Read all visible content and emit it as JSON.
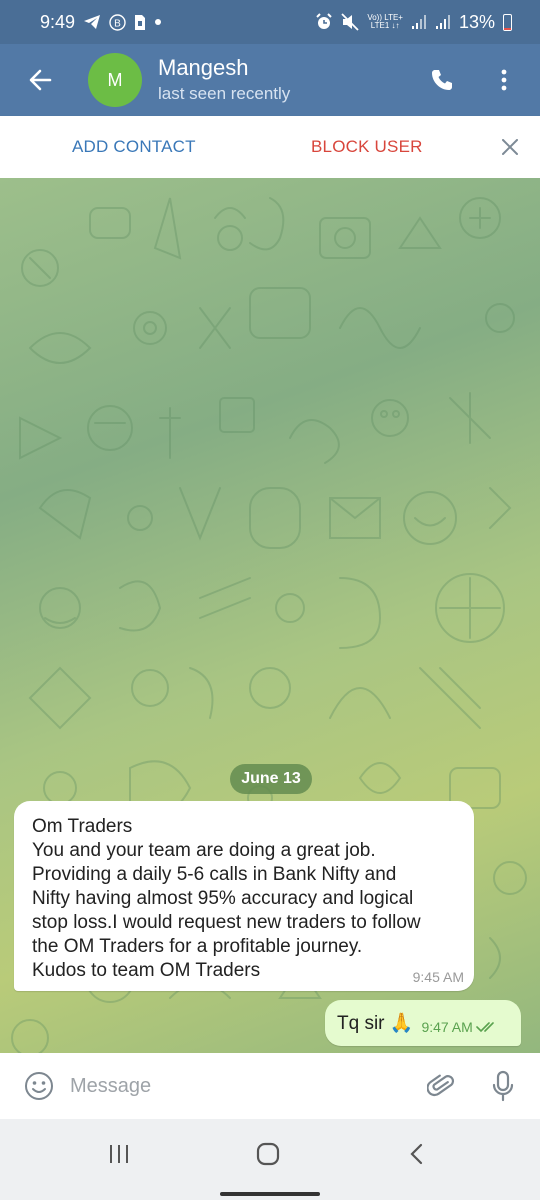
{
  "status_bar": {
    "time": "9:49",
    "network_label": "Vo)) LTE+",
    "network_sub": "LTE1 ↓↑",
    "battery": "13%"
  },
  "header": {
    "avatar_initial": "M",
    "contact_name": "Mangesh",
    "contact_status": "last seen recently"
  },
  "action_bar": {
    "add_contact": "ADD CONTACT",
    "block_user": "BLOCK USER"
  },
  "chat": {
    "date_label": "June 13",
    "incoming": {
      "lines": [
        "Om Traders",
        "You and your team are doing a great job.",
        "Providing a daily 5-6 calls in Bank Nifty and",
        "Nifty having almost 95% accuracy and logical",
        "stop loss.I would request new traders to follow",
        "the OM Traders for a profitable journey.",
        " Kudos to team OM Traders"
      ],
      "time": "9:45 AM"
    },
    "outgoing": {
      "text": "Tq sir 🙏",
      "time": "9:47 AM"
    }
  },
  "composer": {
    "placeholder": "Message"
  },
  "colors": {
    "status_bar": "#4a6e96",
    "app_bar": "#5279a6",
    "avatar": "#6cbd45",
    "add_contact": "#3a78b8",
    "block_user": "#d8463c",
    "outgoing_bubble": "#e5fbcf",
    "read_check": "#5aa24f"
  }
}
